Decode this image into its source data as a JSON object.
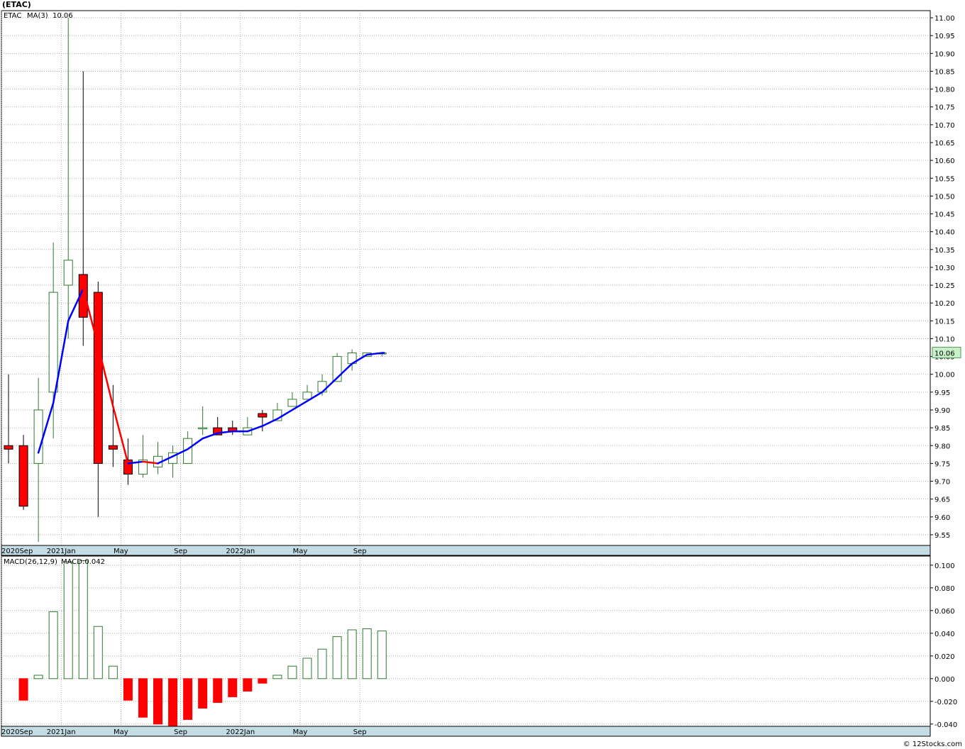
{
  "symbol_title": "(ETAC)",
  "footer": "© 12Stocks.com",
  "colors": {
    "up": "#2f7a2f",
    "down": "#ff0000",
    "ma_up": "#0000ff",
    "ma_down": "#ff0000",
    "axis_strip": "#c4dce4",
    "last_price_bg": "#c8f0c8"
  },
  "chart_data": [
    {
      "type": "candlestick",
      "legend": [
        "ETAC",
        "MA(3)",
        "10.06"
      ],
      "last_price_label": "10.06",
      "ylim": [
        9.52,
        11.02
      ],
      "yticks": [
        "11.00",
        "10.95",
        "10.90",
        "10.85",
        "10.80",
        "10.75",
        "10.70",
        "10.65",
        "10.60",
        "10.55",
        "10.50",
        "10.45",
        "10.40",
        "10.35",
        "10.30",
        "10.25",
        "10.20",
        "10.15",
        "10.10",
        "10.05",
        "10.00",
        "9.95",
        "9.90",
        "9.85",
        "9.80",
        "9.75",
        "9.70",
        "9.65",
        "9.60",
        "9.55"
      ],
      "xticks": [
        {
          "label": "2020Sep",
          "index": 0
        },
        {
          "label": "2021Jan",
          "index": 4
        },
        {
          "label": "May",
          "index": 8
        },
        {
          "label": "Sep",
          "index": 12
        },
        {
          "label": "2022Jan",
          "index": 16
        },
        {
          "label": "May",
          "index": 20
        },
        {
          "label": "Sep",
          "index": 24
        }
      ],
      "candles": [
        {
          "open": 9.8,
          "high": 10.0,
          "low": 9.75,
          "close": 9.79
        },
        {
          "open": 9.8,
          "high": 9.83,
          "low": 9.62,
          "close": 9.63
        },
        {
          "open": 9.75,
          "high": 9.99,
          "low": 9.53,
          "close": 9.9
        },
        {
          "open": 9.95,
          "high": 10.37,
          "low": 9.82,
          "close": 10.23
        },
        {
          "open": 10.25,
          "high": 11.0,
          "low": 10.1,
          "close": 10.32
        },
        {
          "open": 10.28,
          "high": 10.85,
          "low": 10.08,
          "close": 10.16
        },
        {
          "open": 10.23,
          "high": 10.26,
          "low": 9.6,
          "close": 9.75
        },
        {
          "open": 9.8,
          "high": 9.97,
          "low": 9.74,
          "close": 9.79
        },
        {
          "open": 9.76,
          "high": 9.82,
          "low": 9.69,
          "close": 9.72
        },
        {
          "open": 9.72,
          "high": 9.83,
          "low": 9.71,
          "close": 9.76
        },
        {
          "open": 9.74,
          "high": 9.81,
          "low": 9.72,
          "close": 9.77
        },
        {
          "open": 9.75,
          "high": 9.8,
          "low": 9.71,
          "close": 9.78
        },
        {
          "open": 9.75,
          "high": 9.84,
          "low": 9.75,
          "close": 9.82
        },
        {
          "open": 9.85,
          "high": 9.91,
          "low": 9.83,
          "close": 9.85
        },
        {
          "open": 9.85,
          "high": 9.88,
          "low": 9.83,
          "close": 9.83
        },
        {
          "open": 9.85,
          "high": 9.87,
          "low": 9.83,
          "close": 9.84
        },
        {
          "open": 9.83,
          "high": 9.88,
          "low": 9.83,
          "close": 9.85
        },
        {
          "open": 9.89,
          "high": 9.9,
          "low": 9.84,
          "close": 9.88
        },
        {
          "open": 9.87,
          "high": 9.92,
          "low": 9.87,
          "close": 9.9
        },
        {
          "open": 9.91,
          "high": 9.95,
          "low": 9.91,
          "close": 9.93
        },
        {
          "open": 9.93,
          "high": 9.97,
          "low": 9.93,
          "close": 9.95
        },
        {
          "open": 9.95,
          "high": 10.0,
          "low": 9.94,
          "close": 9.98
        },
        {
          "open": 9.98,
          "high": 10.06,
          "low": 9.98,
          "close": 10.05
        },
        {
          "open": 10.03,
          "high": 10.07,
          "low": 10.01,
          "close": 10.06
        },
        {
          "open": 10.05,
          "high": 10.06,
          "low": 10.05,
          "close": 10.06
        },
        {
          "open": 10.06,
          "high": 10.06,
          "low": 10.05,
          "close": 10.06
        }
      ],
      "ma3": [
        null,
        null,
        9.78,
        9.92,
        10.15,
        10.24,
        10.08,
        9.91,
        9.75,
        9.755,
        9.75,
        9.77,
        9.79,
        9.82,
        9.835,
        9.84,
        9.84,
        9.855,
        9.875,
        9.9,
        9.925,
        9.95,
        9.99,
        10.03,
        10.055,
        10.06
      ]
    },
    {
      "type": "bar",
      "legend": [
        "MACD(26,12,9)",
        "MACD:0.042"
      ],
      "ylim": [
        -0.042,
        0.108
      ],
      "yticks": [
        "0.100",
        "0.080",
        "0.060",
        "0.040",
        "0.020",
        "0.000",
        "-0.020",
        "-0.040"
      ],
      "xticks": [
        {
          "label": "2020Sep",
          "index": 0
        },
        {
          "label": "2021Jan",
          "index": 4
        },
        {
          "label": "May",
          "index": 8
        },
        {
          "label": "Sep",
          "index": 12
        },
        {
          "label": "2022Jan",
          "index": 16
        },
        {
          "label": "May",
          "index": 20
        },
        {
          "label": "Sep",
          "index": 24
        }
      ],
      "values": [
        0.0,
        -0.019,
        0.003,
        0.059,
        0.103,
        0.104,
        0.046,
        0.011,
        -0.019,
        -0.034,
        -0.04,
        -0.043,
        -0.036,
        -0.026,
        -0.021,
        -0.016,
        -0.011,
        -0.004,
        0.003,
        0.011,
        0.018,
        0.026,
        0.037,
        0.043,
        0.044,
        0.042
      ]
    }
  ]
}
